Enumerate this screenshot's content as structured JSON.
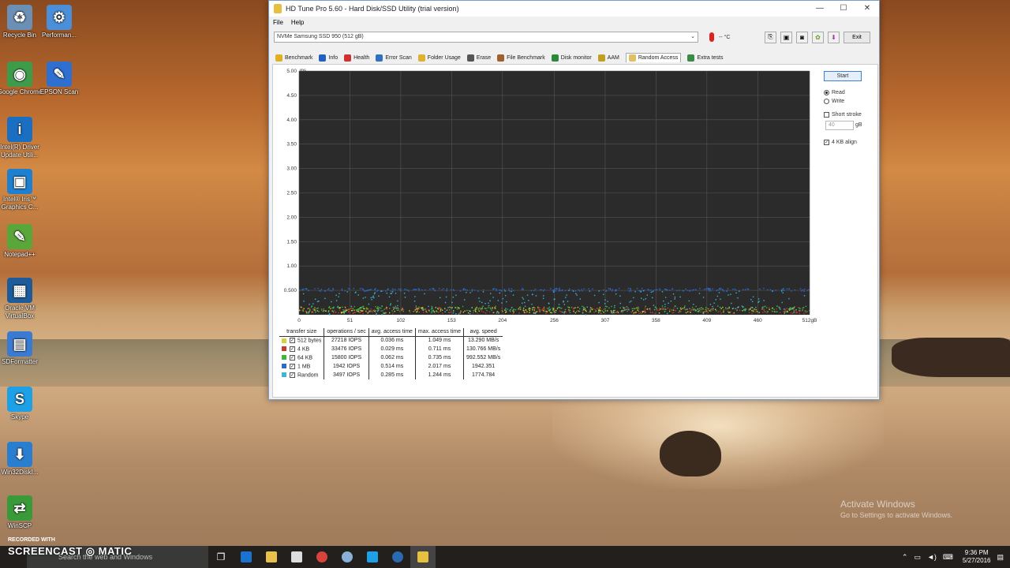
{
  "desktop": {
    "icons": [
      {
        "label": "Recycle Bin",
        "color": "#6b8fb5",
        "glyph": "♻"
      },
      {
        "label": "Performan...",
        "color": "#4a8fd8",
        "glyph": "⚙"
      },
      {
        "label": "Google Chrome",
        "color": "#3d9b4a",
        "glyph": "◉"
      },
      {
        "label": "EPSON Scan",
        "color": "#2f6fd0",
        "glyph": "✎"
      },
      {
        "label": "Intel(R) Driver Update Utili...",
        "color": "#1b6fc2",
        "glyph": "i"
      },
      {
        "label": "Intel® Iris™ Graphics C...",
        "color": "#1f7fd0",
        "glyph": "▣"
      },
      {
        "label": "Notepad++",
        "color": "#5aa63a",
        "glyph": "✎"
      },
      {
        "label": "Oracle VM VirtualBox",
        "color": "#1d5b9a",
        "glyph": "▦"
      },
      {
        "label": "SDFormatter",
        "color": "#3a7ad0",
        "glyph": "▤"
      },
      {
        "label": "Skype",
        "color": "#1ea0e6",
        "glyph": "S"
      },
      {
        "label": "Win32DiskI...",
        "color": "#2a7ed0",
        "glyph": "⬇"
      },
      {
        "label": "WinSCP",
        "color": "#3a9a3a",
        "glyph": "⇄"
      }
    ]
  },
  "window": {
    "title": "HD Tune Pro 5.60 - Hard Disk/SSD Utility (trial version)",
    "menu": [
      "File",
      "Help"
    ],
    "drive": "NVMe   Samsung SSD 950 (512 gB)",
    "temperature": "-- °C",
    "exit_label": "Exit",
    "tabs": [
      {
        "label": "Benchmark",
        "color": "#e0b020"
      },
      {
        "label": "Info",
        "color": "#2060c0"
      },
      {
        "label": "Health",
        "color": "#d03030"
      },
      {
        "label": "Error Scan",
        "color": "#3070c0"
      },
      {
        "label": "Folder Usage",
        "color": "#e0b030"
      },
      {
        "label": "Erase",
        "color": "#555555"
      },
      {
        "label": "File Benchmark",
        "color": "#a06030"
      },
      {
        "label": "Disk monitor",
        "color": "#2a8a3a"
      },
      {
        "label": "AAM",
        "color": "#c0a020"
      },
      {
        "label": "Random Access",
        "color": "#e0c060"
      },
      {
        "label": "Extra tests",
        "color": "#3a8a4a"
      }
    ],
    "controls": {
      "start_label": "Start",
      "read_label": "Read",
      "write_label": "Write",
      "short_stroke_label": "Short stroke",
      "short_stroke_value": "40",
      "short_stroke_unit": "gB",
      "align_label": "4 KB align"
    }
  },
  "chart_data": {
    "type": "scatter",
    "title": "",
    "ylabel_unit": "ms",
    "xlabel_unit": "gB",
    "ylim": [
      0,
      5.0
    ],
    "xlim": [
      0,
      512
    ],
    "y_ticks": [
      "5.00",
      "4.50",
      "4.00",
      "3.50",
      "3.00",
      "2.50",
      "2.00",
      "1.50",
      "1.00",
      "0.500"
    ],
    "x_ticks": [
      "0",
      "51",
      "102",
      "153",
      "204",
      "256",
      "307",
      "358",
      "409",
      "460",
      "512gB"
    ],
    "grid": true,
    "background": "#2b2b2b",
    "series": [
      {
        "name": "512 bytes",
        "color": "#d4d43a",
        "access_ms": 0.036,
        "max_ms": 1.049
      },
      {
        "name": "4 KB",
        "color": "#c83a2a",
        "access_ms": 0.029,
        "max_ms": 0.711
      },
      {
        "name": "64 KB",
        "color": "#3ab83a",
        "access_ms": 0.062,
        "max_ms": 0.735
      },
      {
        "name": "1 MB",
        "color": "#2a6ad0",
        "access_ms": 0.514,
        "max_ms": 2.017
      },
      {
        "name": "Random",
        "color": "#3ab8d8",
        "access_ms": 0.285,
        "max_ms": 1.244
      }
    ]
  },
  "results": {
    "headers": [
      "transfer size",
      "operations / sec",
      "avg. access time",
      "max. access time",
      "avg. speed"
    ],
    "rows": [
      {
        "size": "512 bytes",
        "ops": "27218 IOPS",
        "avg": "0.036 ms",
        "max": "1.049 ms",
        "speed": "13.290 MB/s",
        "color": "#d4d43a"
      },
      {
        "size": "4 KB",
        "ops": "33476 IOPS",
        "avg": "0.029 ms",
        "max": "0.711 ms",
        "speed": "130.766 MB/s",
        "color": "#c83a2a"
      },
      {
        "size": "64 KB",
        "ops": "15800 IOPS",
        "avg": "0.062 ms",
        "max": "0.735 ms",
        "speed": "992.552 MB/s",
        "color": "#3ab83a"
      },
      {
        "size": "1 MB",
        "ops": "1942 IOPS",
        "avg": "0.514 ms",
        "max": "2.017 ms",
        "speed": "1942.351",
        "color": "#2a6ad0"
      },
      {
        "size": "Random",
        "ops": "3497 IOPS",
        "avg": "0.285 ms",
        "max": "1.244 ms",
        "speed": "1774.784",
        "color": "#3ab8d8"
      }
    ]
  },
  "taskbar": {
    "search_placeholder": "Search the web and Windows",
    "time": "9:36 PM",
    "date": "5/27/2016"
  },
  "watermark": {
    "line1": "Activate Windows",
    "line2": "Go to Settings to activate Windows."
  },
  "recorder": {
    "recorded_with": "RECORDED WITH",
    "brand": "SCREENCAST ◎ MATIC"
  }
}
